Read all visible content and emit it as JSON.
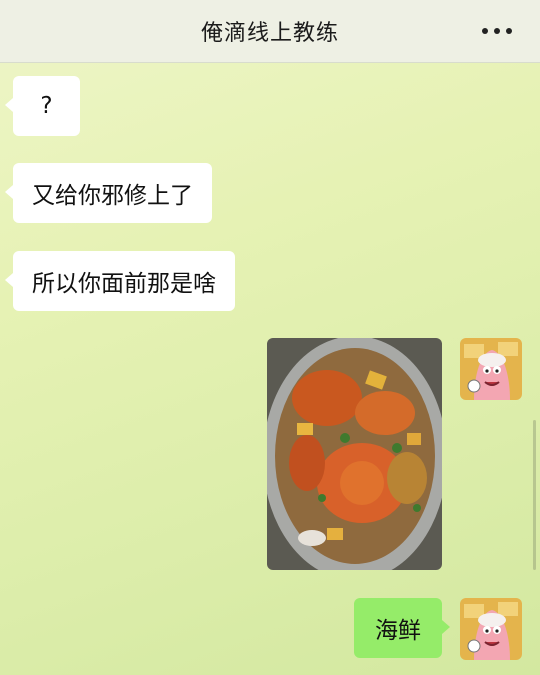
{
  "header": {
    "title": "俺滴线上教练",
    "more_icon": "more-dots-icon"
  },
  "messages": [
    {
      "side": "left",
      "type": "text",
      "text": "?"
    },
    {
      "side": "left",
      "type": "text",
      "text": "又给你邪修上了"
    },
    {
      "side": "left",
      "type": "text",
      "text": "所以你面前那是啥"
    },
    {
      "side": "right",
      "type": "image",
      "subject": "seafood dish"
    },
    {
      "side": "right",
      "type": "text",
      "text": "海鲜"
    }
  ],
  "colors": {
    "own_bubble": "#95ec69",
    "other_bubble": "#ffffff",
    "header_bg": "#eef0e4"
  }
}
